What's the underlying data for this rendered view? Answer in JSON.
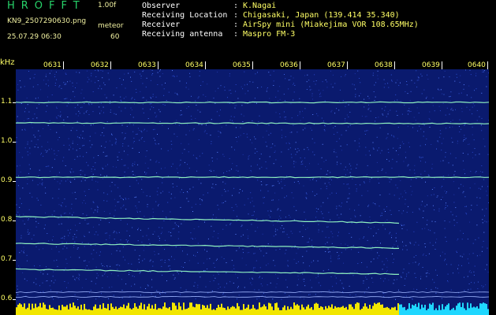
{
  "header": {
    "brand": "HROFFT",
    "version": "1.00f",
    "filename": "KN9_2507290630.png",
    "mode": "meteor",
    "datetime": "25.07.29 06:30",
    "count": "60"
  },
  "meta": [
    {
      "key": "Observer",
      "value": "K.Nagai"
    },
    {
      "key": "Receiving Location",
      "value": "Chigasaki, Japan (139.414 35.340)"
    },
    {
      "key": "Receiver",
      "value": "AirSpy mini (Miakejima VOR 108.65MHz)"
    },
    {
      "key": "Receiving antenna",
      "value": "Maspro FM-3"
    }
  ],
  "axes": {
    "y_unit": "kHz",
    "y_ticks": [
      "1.1",
      "1.0",
      "0.9",
      "0.8",
      "0.7",
      "0.6"
    ],
    "x_ticks": [
      "0631",
      "0632",
      "0633",
      "0634",
      "0635",
      "0636",
      "0637",
      "0638",
      "0639",
      "0640"
    ]
  },
  "colors": {
    "background": "#0a1a6e",
    "trace": "#8ef0c0",
    "label": "#ffff66"
  }
}
